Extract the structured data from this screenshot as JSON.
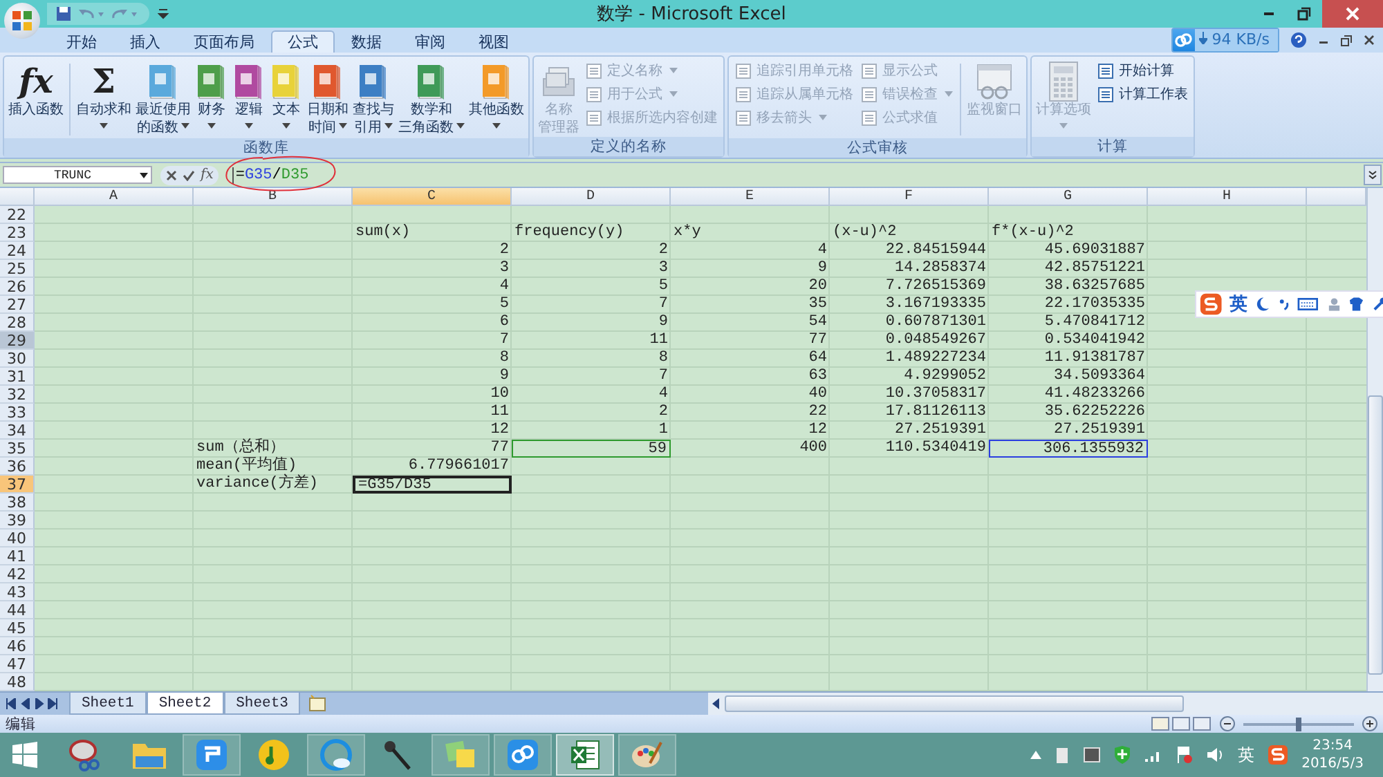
{
  "window": {
    "title": "数学 - Microsoft Excel"
  },
  "ribbon_tabs": [
    {
      "label": "开始",
      "selected": false
    },
    {
      "label": "插入",
      "selected": false
    },
    {
      "label": "页面布局",
      "selected": false
    },
    {
      "label": "公式",
      "selected": true
    },
    {
      "label": "数据",
      "selected": false
    },
    {
      "label": "审阅",
      "selected": false
    },
    {
      "label": "视图",
      "selected": false
    }
  ],
  "download_widget": {
    "speed": "94 KB/s"
  },
  "ribbon_groups": [
    {
      "label": "函数库",
      "items": [
        {
          "kind": "symbol",
          "symbol": "fx",
          "lines": [
            "插入函数"
          ],
          "dropdown": false,
          "disabled": false
        },
        {
          "kind": "separator"
        },
        {
          "kind": "symbol",
          "symbol": "Σ",
          "lines": [
            "自动求和"
          ],
          "dropdown": true,
          "disabled": false
        },
        {
          "kind": "book",
          "color": "#5aa9dc",
          "lines": [
            "最近使用",
            "的函数"
          ],
          "dropdown": true,
          "disabled": false
        },
        {
          "kind": "book",
          "color": "#4e9e4a",
          "lines": [
            "财务"
          ],
          "dropdown": true,
          "disabled": false
        },
        {
          "kind": "book",
          "color": "#b04aa0",
          "lines": [
            "逻辑"
          ],
          "dropdown": true,
          "disabled": false
        },
        {
          "kind": "book",
          "color": "#e8d23a",
          "lines": [
            "文本"
          ],
          "dropdown": true,
          "disabled": false
        },
        {
          "kind": "book",
          "color": "#e0582e",
          "lines": [
            "日期和",
            "时间"
          ],
          "dropdown": true,
          "disabled": false
        },
        {
          "kind": "book",
          "color": "#3d7fc4",
          "lines": [
            "查找与",
            "引用"
          ],
          "dropdown": true,
          "disabled": false
        },
        {
          "kind": "book",
          "color": "#3f9a58",
          "lines": [
            "数学和",
            "三角函数"
          ],
          "dropdown": true,
          "disabled": false
        },
        {
          "kind": "book",
          "color": "#f39a28",
          "lines": [
            "其他函数"
          ],
          "dropdown": true,
          "disabled": false
        }
      ]
    },
    {
      "label": "定义的名称",
      "items": [
        {
          "kind": "tool",
          "lines": [
            "名称",
            "管理器"
          ],
          "dropdown": false,
          "disabled": true
        },
        {
          "kind": "column",
          "buttons": [
            {
              "label": "定义名称",
              "dropdown": true,
              "disabled": true
            },
            {
              "label": "用于公式",
              "dropdown": true,
              "disabled": true
            },
            {
              "label": "根据所选内容创建",
              "dropdown": false,
              "disabled": true
            }
          ]
        }
      ]
    },
    {
      "label": "公式审核",
      "items": [
        {
          "kind": "column",
          "buttons": [
            {
              "label": "追踪引用单元格",
              "dropdown": false,
              "disabled": true
            },
            {
              "label": "追踪从属单元格",
              "dropdown": false,
              "disabled": true
            },
            {
              "label": "移去箭头",
              "dropdown": true,
              "disabled": true
            }
          ]
        },
        {
          "kind": "column",
          "buttons": [
            {
              "label": "显示公式",
              "dropdown": false,
              "disabled": true
            },
            {
              "label": "错误检查",
              "dropdown": true,
              "disabled": true
            },
            {
              "label": "公式求值",
              "dropdown": false,
              "disabled": true
            }
          ]
        },
        {
          "kind": "separator"
        },
        {
          "kind": "tool",
          "lines": [
            "监视窗口"
          ],
          "dropdown": false,
          "disabled": true
        }
      ]
    },
    {
      "label": "计算",
      "items": [
        {
          "kind": "tool",
          "lines": [
            "计算选项"
          ],
          "dropdown": true,
          "disabled": true
        },
        {
          "kind": "column",
          "buttons": [
            {
              "label": "开始计算",
              "dropdown": false,
              "disabled": false
            },
            {
              "label": "计算工作表",
              "dropdown": false,
              "disabled": false
            }
          ]
        }
      ]
    }
  ],
  "formula_bar": {
    "name_box": "TRUNC",
    "function_symbol": "fx",
    "formula": [
      {
        "text": "=",
        "color": "#000000"
      },
      {
        "text": "G35",
        "color": "#2b3fe0"
      },
      {
        "text": "/",
        "color": "#000000"
      },
      {
        "text": "D35",
        "color": "#2e9a2e"
      }
    ]
  },
  "columns": [
    {
      "label": "A",
      "selected": false
    },
    {
      "label": "B",
      "selected": false
    },
    {
      "label": "C",
      "selected": true
    },
    {
      "label": "D",
      "selected": false
    },
    {
      "label": "E",
      "selected": false
    },
    {
      "label": "F",
      "selected": false
    },
    {
      "label": "G",
      "selected": false
    },
    {
      "label": "H",
      "selected": false
    }
  ],
  "rows": [
    {
      "number": "22",
      "selected": false,
      "highlighted": false
    },
    {
      "number": "23",
      "selected": false,
      "highlighted": false,
      "cells": {
        "C": {
          "kind": "text",
          "text": "sum(x)"
        },
        "D": {
          "kind": "text",
          "text": "frequency(y)"
        },
        "E": {
          "kind": "text",
          "text": "x*y"
        },
        "F": {
          "kind": "text",
          "text": "(x-u)^2"
        },
        "G": {
          "kind": "text",
          "text": "f*(x-u)^2"
        }
      }
    },
    {
      "number": "24",
      "selected": false,
      "highlighted": false,
      "cells": {
        "C": {
          "kind": "number",
          "text": "2"
        },
        "D": {
          "kind": "number",
          "text": "2"
        },
        "E": {
          "kind": "number",
          "text": "4"
        },
        "F": {
          "kind": "number",
          "text": "22.84515944"
        },
        "G": {
          "kind": "number",
          "text": "45.69031887"
        }
      }
    },
    {
      "number": "25",
      "selected": false,
      "highlighted": false,
      "cells": {
        "C": {
          "kind": "number",
          "text": "3"
        },
        "D": {
          "kind": "number",
          "text": "3"
        },
        "E": {
          "kind": "number",
          "text": "9"
        },
        "F": {
          "kind": "number",
          "text": "14.2858374"
        },
        "G": {
          "kind": "number",
          "text": "42.85751221"
        }
      }
    },
    {
      "number": "26",
      "selected": false,
      "highlighted": false,
      "cells": {
        "C": {
          "kind": "number",
          "text": "4"
        },
        "D": {
          "kind": "number",
          "text": "5"
        },
        "E": {
          "kind": "number",
          "text": "20"
        },
        "F": {
          "kind": "number",
          "text": "7.726515369"
        },
        "G": {
          "kind": "number",
          "text": "38.63257685"
        }
      }
    },
    {
      "number": "27",
      "selected": false,
      "highlighted": false,
      "cells": {
        "C": {
          "kind": "number",
          "text": "5"
        },
        "D": {
          "kind": "number",
          "text": "7"
        },
        "E": {
          "kind": "number",
          "text": "35"
        },
        "F": {
          "kind": "number",
          "text": "3.167193335"
        },
        "G": {
          "kind": "number",
          "text": "22.17035335"
        }
      }
    },
    {
      "number": "28",
      "selected": false,
      "highlighted": false,
      "cells": {
        "C": {
          "kind": "number",
          "text": "6"
        },
        "D": {
          "kind": "number",
          "text": "9"
        },
        "E": {
          "kind": "number",
          "text": "54"
        },
        "F": {
          "kind": "number",
          "text": "0.607871301"
        },
        "G": {
          "kind": "number",
          "text": "5.470841712"
        }
      }
    },
    {
      "number": "29",
      "selected": false,
      "highlighted": true,
      "cells": {
        "C": {
          "kind": "number",
          "text": "7"
        },
        "D": {
          "kind": "number",
          "text": "11"
        },
        "E": {
          "kind": "number",
          "text": "77"
        },
        "F": {
          "kind": "number",
          "text": "0.048549267"
        },
        "G": {
          "kind": "number",
          "text": "0.534041942"
        }
      }
    },
    {
      "number": "30",
      "selected": false,
      "highlighted": false,
      "cells": {
        "C": {
          "kind": "number",
          "text": "8"
        },
        "D": {
          "kind": "number",
          "text": "8"
        },
        "E": {
          "kind": "number",
          "text": "64"
        },
        "F": {
          "kind": "number",
          "text": "1.489227234"
        },
        "G": {
          "kind": "number",
          "text": "11.91381787"
        }
      }
    },
    {
      "number": "31",
      "selected": false,
      "highlighted": false,
      "cells": {
        "C": {
          "kind": "number",
          "text": "9"
        },
        "D": {
          "kind": "number",
          "text": "7"
        },
        "E": {
          "kind": "number",
          "text": "63"
        },
        "F": {
          "kind": "number",
          "text": "4.9299052"
        },
        "G": {
          "kind": "number",
          "text": "34.5093364"
        }
      }
    },
    {
      "number": "32",
      "selected": false,
      "highlighted": false,
      "cells": {
        "C": {
          "kind": "number",
          "text": "10"
        },
        "D": {
          "kind": "number",
          "text": "4"
        },
        "E": {
          "kind": "number",
          "text": "40"
        },
        "F": {
          "kind": "number",
          "text": "10.37058317"
        },
        "G": {
          "kind": "number",
          "text": "41.48233266"
        }
      }
    },
    {
      "number": "33",
      "selected": false,
      "highlighted": false,
      "cells": {
        "C": {
          "kind": "number",
          "text": "11"
        },
        "D": {
          "kind": "number",
          "text": "2"
        },
        "E": {
          "kind": "number",
          "text": "22"
        },
        "F": {
          "kind": "number",
          "text": "17.81126113"
        },
        "G": {
          "kind": "number",
          "text": "35.62252226"
        }
      }
    },
    {
      "number": "34",
      "selected": false,
      "highlighted": false,
      "cells": {
        "C": {
          "kind": "number",
          "text": "12"
        },
        "D": {
          "kind": "number",
          "text": "1"
        },
        "E": {
          "kind": "number",
          "text": "12"
        },
        "F": {
          "kind": "number",
          "text": "27.2519391"
        },
        "G": {
          "kind": "number",
          "text": "27.2519391"
        }
      }
    },
    {
      "number": "35",
      "selected": false,
      "highlighted": false,
      "cells": {
        "B": {
          "kind": "text",
          "text": "sum（总和）"
        },
        "C": {
          "kind": "number",
          "text": "77"
        },
        "D": {
          "kind": "reference",
          "text": "59",
          "color": "#2e9a2e"
        },
        "E": {
          "kind": "number",
          "text": "400"
        },
        "F": {
          "kind": "number",
          "text": "110.5340419"
        },
        "G": {
          "kind": "reference",
          "text": "306.1355932",
          "color": "#2b3fe0"
        }
      }
    },
    {
      "number": "36",
      "selected": false,
      "highlighted": false,
      "cells": {
        "B": {
          "kind": "text",
          "text": "mean(平均值)"
        },
        "C": {
          "kind": "number",
          "text": "6.779661017"
        }
      }
    },
    {
      "number": "37",
      "selected": true,
      "highlighted": false,
      "cells": {
        "B": {
          "kind": "text",
          "text": "variance(方差)"
        },
        "C": {
          "kind": "editing",
          "text": "=G35/D35"
        }
      }
    },
    {
      "number": "38",
      "selected": false,
      "highlighted": false
    },
    {
      "number": "39",
      "selected": false,
      "highlighted": false
    },
    {
      "number": "40",
      "selected": false,
      "highlighted": false
    },
    {
      "number": "41",
      "selected": false,
      "highlighted": false
    },
    {
      "number": "42",
      "selected": false,
      "highlighted": false
    },
    {
      "number": "43",
      "selected": false,
      "highlighted": false
    },
    {
      "number": "44",
      "selected": false,
      "highlighted": false
    },
    {
      "number": "45",
      "selected": false,
      "highlighted": false
    },
    {
      "number": "46",
      "selected": false,
      "highlighted": false
    },
    {
      "number": "47",
      "selected": false,
      "highlighted": false
    },
    {
      "number": "48",
      "selected": false,
      "highlighted": false
    }
  ],
  "sheet_tabs": [
    {
      "label": "Sheet1",
      "selected": false
    },
    {
      "label": "Sheet2",
      "selected": true
    },
    {
      "label": "Sheet3",
      "selected": false
    }
  ],
  "status_bar": {
    "mode": "编辑",
    "zoom": {
      "level": 0.5
    }
  },
  "ime_bar": {
    "mode": "英"
  },
  "taskbar": {
    "apps": [
      {
        "running": false,
        "selected": false
      },
      {
        "running": false,
        "selected": false
      },
      {
        "running": true,
        "selected": false
      },
      {
        "running": false,
        "selected": false
      },
      {
        "running": true,
        "selected": false
      },
      {
        "running": false,
        "selected": false
      },
      {
        "running": true,
        "selected": false
      },
      {
        "running": true,
        "selected": false
      },
      {
        "running": true,
        "selected": true
      },
      {
        "running": true,
        "selected": false
      }
    ],
    "input_mode": "英",
    "time": "23:54",
    "date": "2016/5/3"
  }
}
